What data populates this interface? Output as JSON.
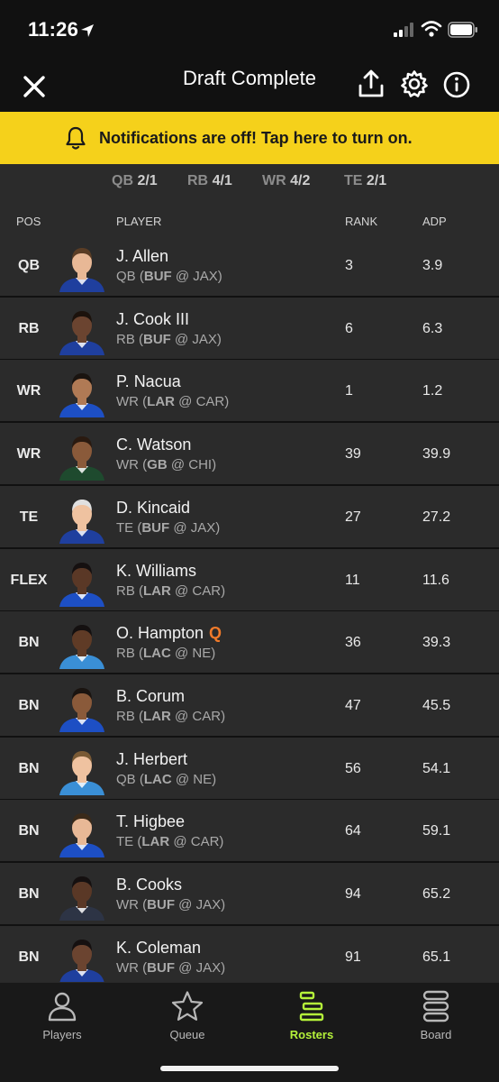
{
  "status_bar": {
    "time": "11:26"
  },
  "nav": {
    "title": "Draft Complete",
    "icons": [
      "close-icon",
      "share-icon",
      "gear-icon",
      "info-icon"
    ]
  },
  "notification": {
    "text": "Notifications are off! Tap here to turn on.",
    "icon": "bell-icon"
  },
  "position_counts": [
    {
      "pos": "QB",
      "value": "2/1"
    },
    {
      "pos": "RB",
      "value": "4/1"
    },
    {
      "pos": "WR",
      "value": "4/2"
    },
    {
      "pos": "TE",
      "value": "2/1"
    }
  ],
  "columns": {
    "pos": "POS",
    "player": "PLAYER",
    "rank": "RANK",
    "adp": "ADP"
  },
  "roster": [
    {
      "slot": "QB",
      "name": "J. Allen",
      "injury": "",
      "pos": "QB",
      "team": "BUF",
      "opp": "@ JAX",
      "rank": "3",
      "adp": "3.9",
      "jersey": "#1f3f9e",
      "skin": "#e8b896",
      "hair": "#5a3d25"
    },
    {
      "slot": "RB",
      "name": "J. Cook III",
      "injury": "",
      "pos": "RB",
      "team": "BUF",
      "opp": "@ JAX",
      "rank": "6",
      "adp": "6.3",
      "jersey": "#1f3f9e",
      "skin": "#6b4430",
      "hair": "#1c120c"
    },
    {
      "slot": "WR",
      "name": "P. Nacua",
      "injury": "",
      "pos": "WR",
      "team": "LAR",
      "opp": "@ CAR",
      "rank": "1",
      "adp": "1.2",
      "jersey": "#1d4fc4",
      "skin": "#b07a55",
      "hair": "#1a1410"
    },
    {
      "slot": "WR",
      "name": "C. Watson",
      "injury": "",
      "pos": "WR",
      "team": "GB",
      "opp": "@ CHI",
      "rank": "39",
      "adp": "39.9",
      "jersey": "#1e4a2e",
      "skin": "#8a5a3a",
      "hair": "#2a1a10"
    },
    {
      "slot": "TE",
      "name": "D. Kincaid",
      "injury": "",
      "pos": "TE",
      "team": "BUF",
      "opp": "@ JAX",
      "rank": "27",
      "adp": "27.2",
      "jersey": "#1f3f9e",
      "skin": "#efc2a0",
      "hair": "#e0e0e0"
    },
    {
      "slot": "FLEX",
      "name": "K. Williams",
      "injury": "",
      "pos": "RB",
      "team": "LAR",
      "opp": "@ CAR",
      "rank": "11",
      "adp": "11.6",
      "jersey": "#1d4fc4",
      "skin": "#5a3826",
      "hair": "#151010"
    },
    {
      "slot": "BN",
      "name": "O. Hampton",
      "injury": "Q",
      "pos": "RB",
      "team": "LAC",
      "opp": "@ NE",
      "rank": "36",
      "adp": "39.3",
      "jersey": "#3a8fd6",
      "skin": "#5f3b26",
      "hair": "#141010"
    },
    {
      "slot": "BN",
      "name": "B. Corum",
      "injury": "",
      "pos": "RB",
      "team": "LAR",
      "opp": "@ CAR",
      "rank": "47",
      "adp": "45.5",
      "jersey": "#1d4fc4",
      "skin": "#8a5a3a",
      "hair": "#1a1410"
    },
    {
      "slot": "BN",
      "name": "J. Herbert",
      "injury": "",
      "pos": "QB",
      "team": "LAC",
      "opp": "@ NE",
      "rank": "56",
      "adp": "54.1",
      "jersey": "#3a8fd6",
      "skin": "#efc2a0",
      "hair": "#7a5a35"
    },
    {
      "slot": "BN",
      "name": "T. Higbee",
      "injury": "",
      "pos": "TE",
      "team": "LAR",
      "opp": "@ CAR",
      "rank": "64",
      "adp": "59.1",
      "jersey": "#1d4fc4",
      "skin": "#e8b896",
      "hair": "#3a2a1a"
    },
    {
      "slot": "BN",
      "name": "B. Cooks",
      "injury": "",
      "pos": "WR",
      "team": "BUF",
      "opp": "@ JAX",
      "rank": "94",
      "adp": "65.2",
      "jersey": "#2d3445",
      "skin": "#5a3826",
      "hair": "#151010"
    },
    {
      "slot": "BN",
      "name": "K. Coleman",
      "injury": "",
      "pos": "WR",
      "team": "BUF",
      "opp": "@ JAX",
      "rank": "91",
      "adp": "65.1",
      "jersey": "#1f3f9e",
      "skin": "#6b4430",
      "hair": "#151010"
    }
  ],
  "tabs": [
    {
      "label": "Players",
      "icon": "person-icon",
      "active": false
    },
    {
      "label": "Queue",
      "icon": "star-icon",
      "active": false
    },
    {
      "label": "Rosters",
      "icon": "rosters-icon",
      "active": true
    },
    {
      "label": "Board",
      "icon": "board-icon",
      "active": false
    }
  ],
  "colors": {
    "accent": "#b5f23a",
    "banner": "#f5d11b",
    "injury": "#f07a2a",
    "row_bg": "#2b2b2b"
  }
}
